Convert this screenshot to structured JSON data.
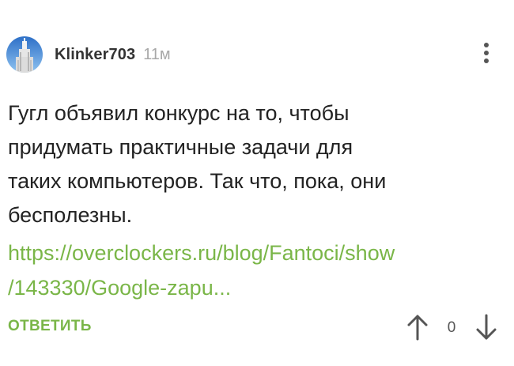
{
  "comment": {
    "username": "Klinker703",
    "timestamp": "11м",
    "body_lines": [
      "Гугл объявил конкурс на то, чтобы",
      "придумать практичные задачи для",
      "таких компьютеров. Так что, пока, они",
      "бесполезны."
    ],
    "link_lines": [
      "https://overclockers.ru/blog/Fantoci/show",
      "/143330/Google-zapu..."
    ],
    "actions": {
      "reply_label": "ОТВЕТИТЬ",
      "vote_count": "0",
      "upvote_icon": "arrow-up-icon",
      "downvote_icon": "arrow-down-icon",
      "more_icon": "more-vertical-icon"
    },
    "colors": {
      "accent_green": "#7ab648",
      "username": "#333333",
      "timestamp": "#a8a8a8",
      "body_text": "#222222",
      "icon": "#555555"
    }
  }
}
